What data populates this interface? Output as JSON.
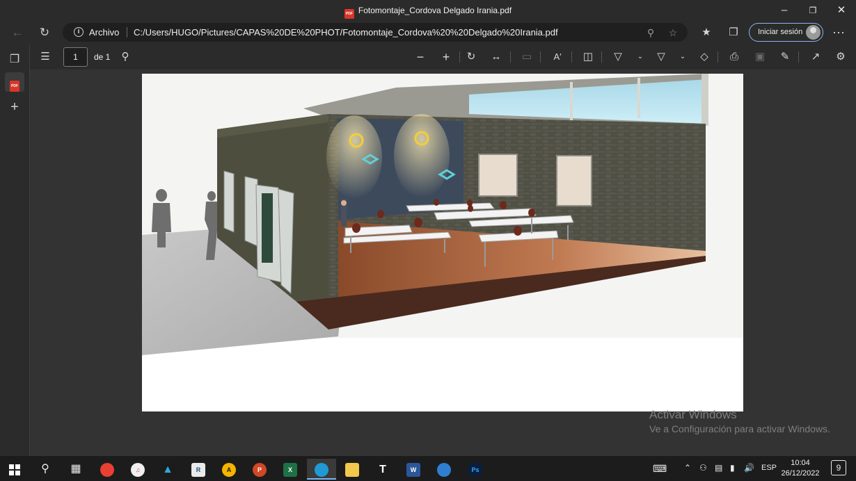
{
  "window": {
    "title": "Fotomontaje_Cordova Delgado Irania.pdf",
    "pdf_badge": "PDF"
  },
  "address_bar": {
    "site_label": "Archivo",
    "url": "C:/Users/HUGO/Pictures/CAPAS%20DE%20PHOT/Fotomontaje_Cordova%20%20Delgado%20Irania.pdf",
    "signin_label": "Iniciar sesión"
  },
  "pdf_toolbar": {
    "current_page": "1",
    "page_count": "de 1"
  },
  "watermark": {
    "line1": "Activar Windows",
    "line2": "Ve a Configuración para activar Windows."
  },
  "taskbar": {
    "language": "ESP",
    "time": "10:04",
    "date": "26/12/2022",
    "notifications": "9",
    "apps": [
      "chrome",
      "itunes",
      "autodesk",
      "revit",
      "autocad",
      "powerpoint",
      "excel",
      "edge",
      "file-explorer",
      "typora",
      "word",
      "edge-beta",
      "photoshop"
    ],
    "app_labels": {
      "revit": "R",
      "autocad": "A",
      "powerpoint": "P",
      "excel": "X",
      "word": "W",
      "photoshop": "Ps",
      "typora": "T"
    }
  },
  "colors": {
    "chrome_bg": "#2b2b2b",
    "viewer_bg": "#333333",
    "accent": "#8ab4f8",
    "pdf_red": "#d9362b"
  }
}
